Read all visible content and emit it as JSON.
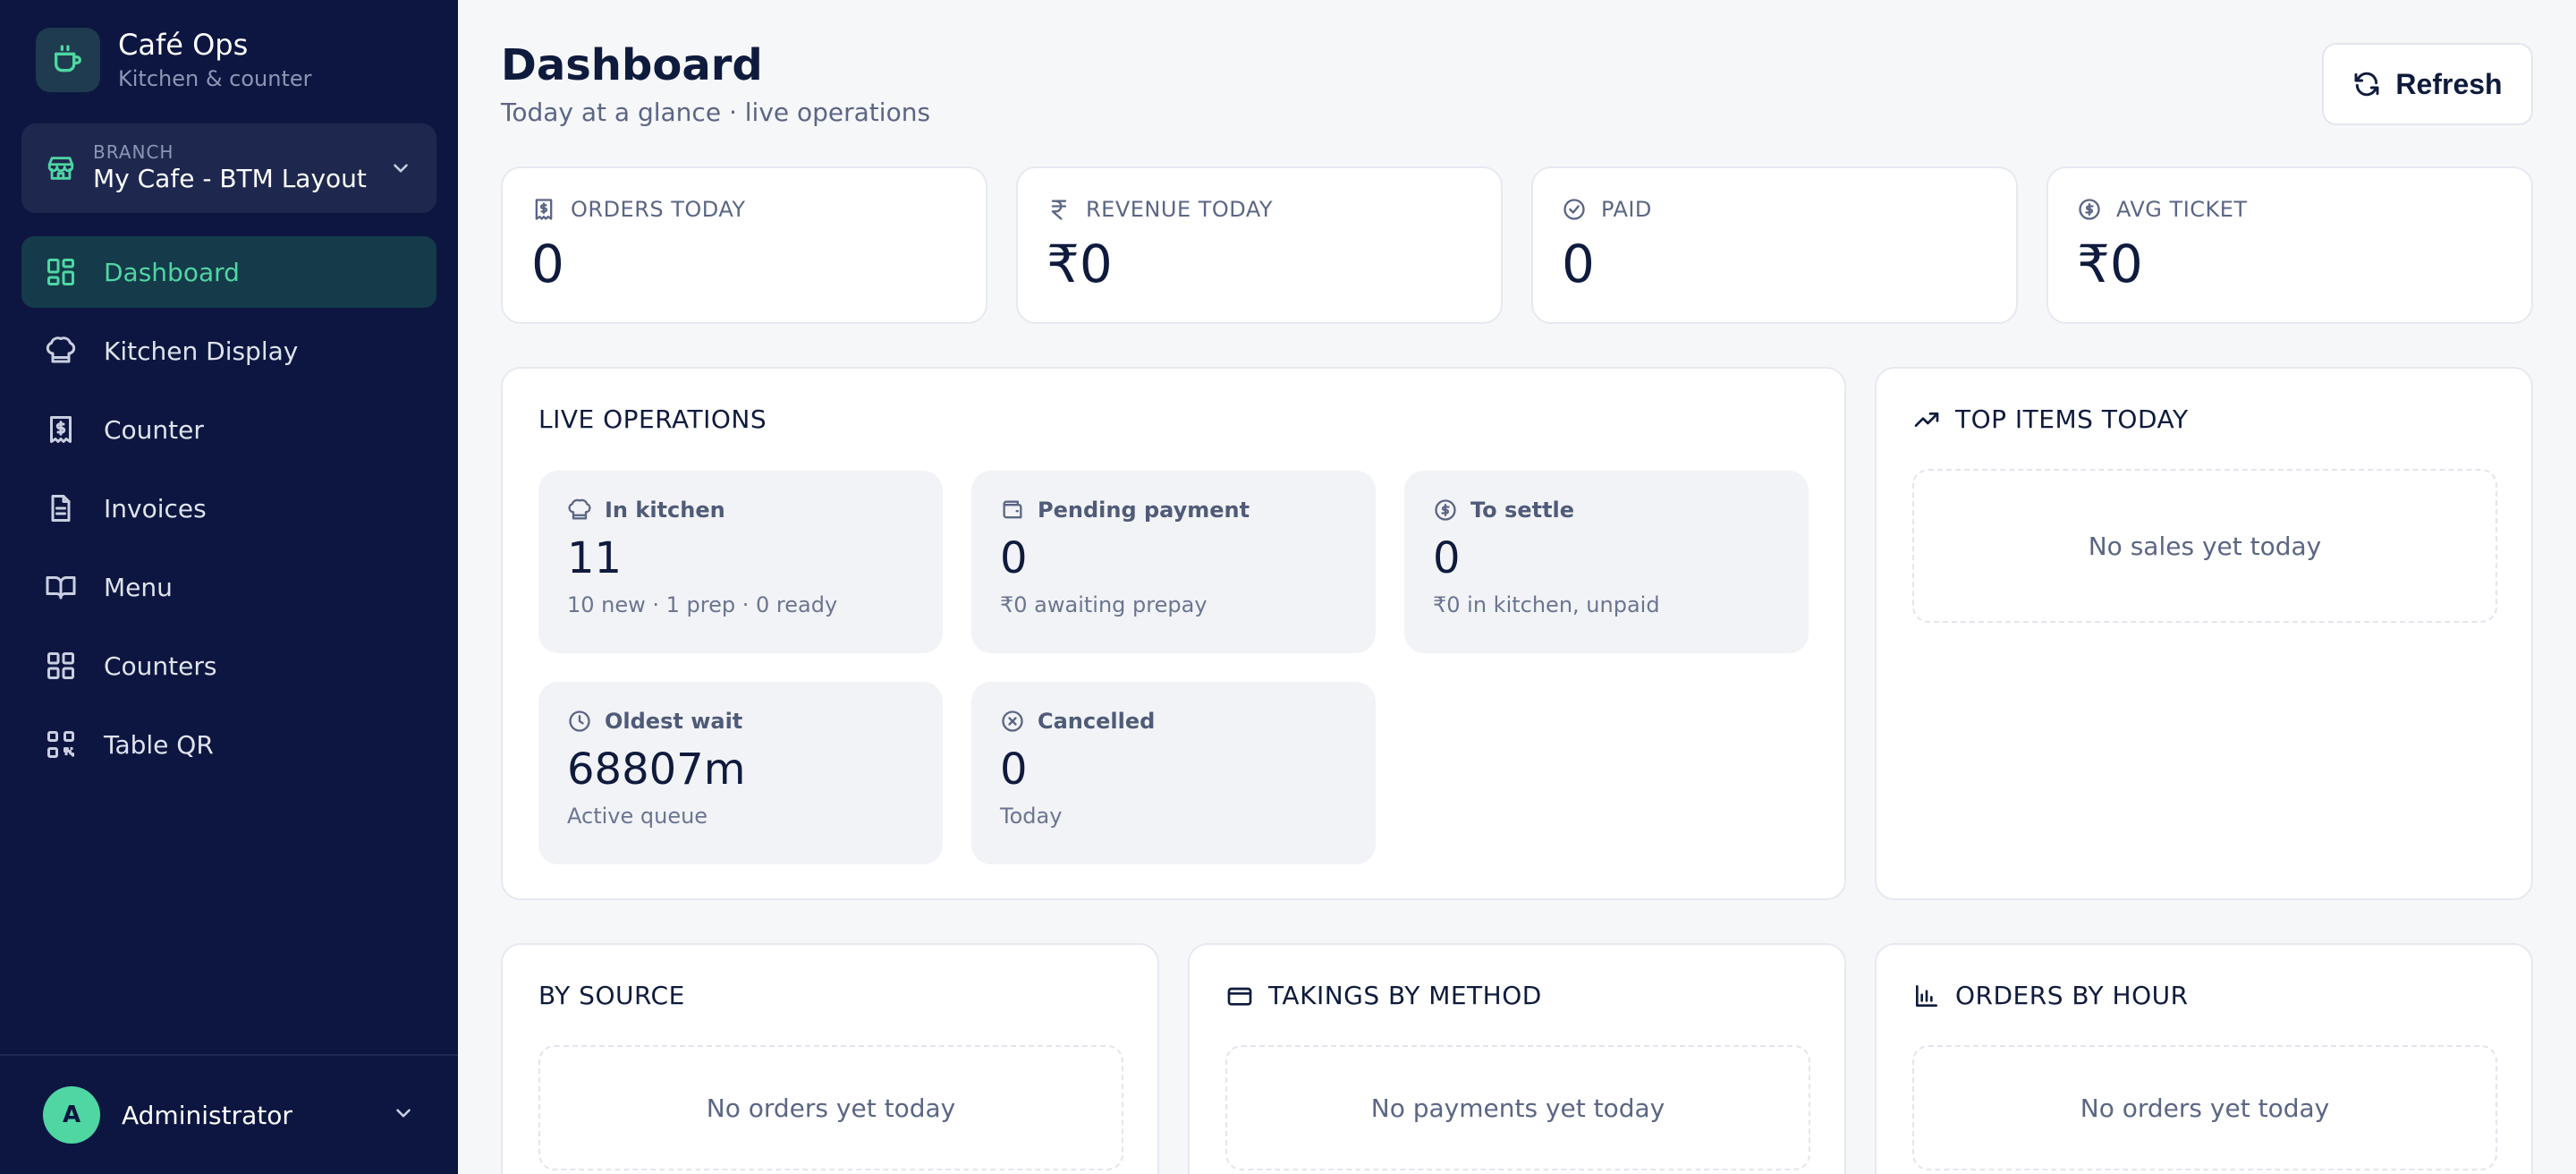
{
  "brand": {
    "title": "Café Ops",
    "subtitle": "Kitchen & counter"
  },
  "branch": {
    "label": "BRANCH",
    "value": "My Cafe - BTM Layout"
  },
  "nav": [
    {
      "label": "Dashboard",
      "icon": "grid-icon",
      "active": true
    },
    {
      "label": "Kitchen Display",
      "icon": "chef-hat-icon"
    },
    {
      "label": "Counter",
      "icon": "receipt-icon"
    },
    {
      "label": "Invoices",
      "icon": "document-icon"
    },
    {
      "label": "Menu",
      "icon": "book-icon"
    },
    {
      "label": "Counters",
      "icon": "squares-icon"
    },
    {
      "label": "Table QR",
      "icon": "qr-icon"
    }
  ],
  "user": {
    "initial": "A",
    "name": "Administrator"
  },
  "header": {
    "title": "Dashboard",
    "subtitle": "Today at a glance · live operations",
    "refresh_label": "Refresh"
  },
  "stats": [
    {
      "label": "ORDERS TODAY",
      "value": "0",
      "icon": "receipt-icon"
    },
    {
      "label": "REVENUE TODAY",
      "value": "₹0",
      "icon": "rupee-icon"
    },
    {
      "label": "PAID",
      "value": "0",
      "icon": "check-circle-icon"
    },
    {
      "label": "AVG TICKET",
      "value": "₹0",
      "icon": "dollar-circle-icon"
    }
  ],
  "live_ops": {
    "title": "LIVE OPERATIONS",
    "tiles": [
      {
        "label": "In kitchen",
        "value": "11",
        "sub": "10 new · 1 prep · 0 ready",
        "icon": "chef-hat-icon"
      },
      {
        "label": "Pending payment",
        "value": "0",
        "sub": "₹0 awaiting prepay",
        "icon": "wallet-icon"
      },
      {
        "label": "To settle",
        "value": "0",
        "sub": "₹0 in kitchen, unpaid",
        "icon": "dollar-circle-icon"
      },
      {
        "label": "Oldest wait",
        "value": "68807m",
        "sub": "Active queue",
        "icon": "clock-icon"
      },
      {
        "label": "Cancelled",
        "value": "0",
        "sub": "Today",
        "icon": "x-circle-icon"
      }
    ]
  },
  "top_items": {
    "title": "TOP ITEMS TODAY",
    "empty": "No sales yet today"
  },
  "by_source": {
    "title": "BY SOURCE",
    "empty": "No orders yet today"
  },
  "takings": {
    "title": "TAKINGS BY METHOD",
    "empty": "No payments yet today"
  },
  "by_hour": {
    "title": "ORDERS BY HOUR",
    "empty": "No orders yet today"
  },
  "colors": {
    "sidebar": "#0d1640",
    "accent": "#4fd6a3",
    "active_bg": "#153a4a",
    "page_bg": "#f6f7f9"
  }
}
